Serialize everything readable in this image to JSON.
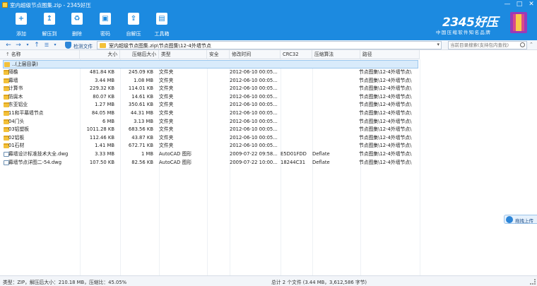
{
  "window": {
    "title": "室内超级节点图集.zip - 2345好压",
    "controls": [
      "—",
      "□",
      "✕"
    ]
  },
  "toolbar": {
    "items": [
      {
        "label": "添加",
        "icon": "add-icon",
        "glyph": "+"
      },
      {
        "label": "解压到",
        "icon": "extract-to-icon",
        "glyph": "↥"
      },
      {
        "label": "删除",
        "icon": "delete-icon",
        "glyph": "♻"
      },
      {
        "label": "密码",
        "icon": "lock-icon",
        "glyph": "▣"
      },
      {
        "label": "自解压",
        "icon": "self-extract-icon",
        "glyph": "⇪"
      },
      {
        "label": "工具箱",
        "icon": "toolbox-icon",
        "glyph": "▤"
      }
    ]
  },
  "brand": {
    "logo_text": "2345好压",
    "slogan": "中国压缩软件知名品牌"
  },
  "address": {
    "scan_label": "检测文件",
    "path": "室内超级节点图集.zip\\节点图集\\12-4外墙节点",
    "search_placeholder": "当前目录搜索(支持包内查找)"
  },
  "table": {
    "headers": [
      "名称",
      "大小",
      "压缩后大小",
      "类型",
      "安全",
      "修改时间",
      "CRC32",
      "压缩算法",
      "路径"
    ],
    "up_row": "..(上层目录)",
    "rows": [
      {
        "name": "隔檐",
        "kind": "folder",
        "size": "481.84 KB",
        "packed": "245.09 KB",
        "type": "文件夹",
        "modified": "2012-06-10 00:05...",
        "crc": "",
        "method": "",
        "path": "节点图集\\12-4外墙节点\\"
      },
      {
        "name": "幕墙",
        "kind": "folder",
        "size": "3.44 MB",
        "packed": "1.08 MB",
        "type": "文件夹",
        "modified": "2012-06-10 00:05...",
        "crc": "",
        "method": "",
        "path": "节点图集\\12-4外墙节点\\"
      },
      {
        "name": "计算书",
        "kind": "folder",
        "size": "229.32 KB",
        "packed": "114.01 KB",
        "type": "文件夹",
        "modified": "2012-06-10 00:05...",
        "crc": "",
        "method": "",
        "path": "节点图集\\12-4外墙节点\\"
      },
      {
        "name": "防腐木",
        "kind": "folder",
        "size": "80.07 KB",
        "packed": "14.61 KB",
        "type": "文件夹",
        "modified": "2012-06-10 00:05...",
        "crc": "",
        "method": "",
        "path": "节点图集\\12-4外墙节点\\"
      },
      {
        "name": "东亚铝业",
        "kind": "folder",
        "size": "1.27 MB",
        "packed": "350.61 KB",
        "type": "文件夹",
        "modified": "2012-06-10 00:05...",
        "crc": "",
        "method": "",
        "path": "节点图集\\12-4外墙节点\\"
      },
      {
        "name": "11和平幕墙节点",
        "kind": "folder",
        "size": "84.05 MB",
        "packed": "44.31 MB",
        "type": "文件夹",
        "modified": "2012-06-10 00:05...",
        "crc": "",
        "method": "",
        "path": "节点图集\\12-4外墙节点\\"
      },
      {
        "name": "04门头",
        "kind": "folder",
        "size": "6 MB",
        "packed": "3.13 MB",
        "type": "文件夹",
        "modified": "2012-06-10 00:05...",
        "crc": "",
        "method": "",
        "path": "节点图集\\12-4外墙节点\\"
      },
      {
        "name": "03铝塑板",
        "kind": "folder",
        "size": "1011.28 KB",
        "packed": "683.56 KB",
        "type": "文件夹",
        "modified": "2012-06-10 00:05...",
        "crc": "",
        "method": "",
        "path": "节点图集\\12-4外墙节点\\"
      },
      {
        "name": "02铝板",
        "kind": "folder",
        "size": "112.46 KB",
        "packed": "43.87 KB",
        "type": "文件夹",
        "modified": "2012-06-10 00:05...",
        "crc": "",
        "method": "",
        "path": "节点图集\\12-4外墙节点\\"
      },
      {
        "name": "01石材",
        "kind": "folder",
        "size": "1.41 MB",
        "packed": "672.71 KB",
        "type": "文件夹",
        "modified": "2012-06-10 00:05...",
        "crc": "",
        "method": "",
        "path": "节点图集\\12-4外墙节点\\"
      },
      {
        "name": "幕墙设计标准技术大全.dwg",
        "kind": "file",
        "size": "3.33 MB",
        "packed": "1 MB",
        "type": "AutoCAD 图形",
        "modified": "2009-07-22 09:58...",
        "crc": "E5D01FDD",
        "method": "Deflate",
        "path": "节点图集\\12-4外墙节点\\"
      },
      {
        "name": "幕墙节点详图二-54.dwg",
        "kind": "file",
        "size": "107.50 KB",
        "packed": "82.56 KB",
        "type": "AutoCAD 图形",
        "modified": "2009-07-22 10:00...",
        "crc": "18244C31",
        "method": "Deflate",
        "path": "节点图集\\12-4外墙节点\\"
      }
    ]
  },
  "side_button": {
    "label": "拖拽上传"
  },
  "status": {
    "left": "类型：ZIP，解压后大小：210.18 MB，压缩比：45.05%",
    "center": "总计 2 个文件 (3.44 MB，3,612,586 字节)"
  }
}
